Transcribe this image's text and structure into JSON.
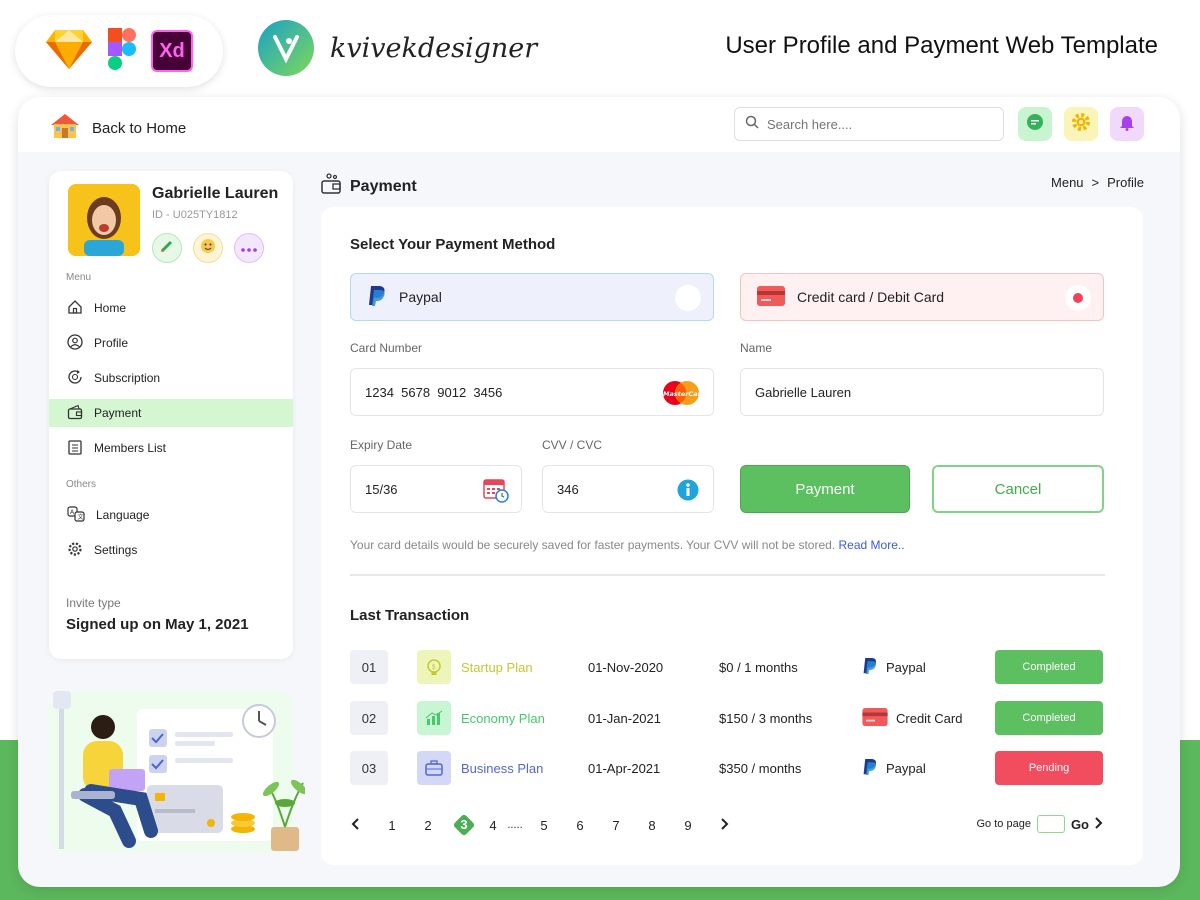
{
  "header": {
    "tools": [
      "sketch-icon",
      "figma-icon",
      "xd-icon"
    ],
    "xd_text": "Xd",
    "brand_name": "kvivekdesigner",
    "title": "User Profile and Payment Web Template"
  },
  "topbar": {
    "back_label": "Back to Home",
    "search_placeholder": "Search here....",
    "icons": [
      "chat-icon",
      "gear-icon",
      "notification-icon"
    ]
  },
  "profile": {
    "name": "Gabrielle Lauren",
    "id": "ID - U025TY1812"
  },
  "sidebar": {
    "menu_label": "Menu",
    "items": [
      {
        "label": "Home",
        "icon": "home-icon"
      },
      {
        "label": "Profile",
        "icon": "user-icon"
      },
      {
        "label": "Subscription",
        "icon": "subscription-icon"
      },
      {
        "label": "Payment",
        "icon": "wallet-icon"
      },
      {
        "label": "Members List",
        "icon": "list-icon"
      }
    ],
    "others_label": "Others",
    "others": [
      {
        "label": "Language",
        "icon": "language-icon"
      },
      {
        "label": "Settings",
        "icon": "settings-icon"
      }
    ],
    "invite_label": "Invite type",
    "invite_value": "Signed up on May 1, 2021"
  },
  "page": {
    "title": "Payment",
    "breadcrumb": [
      "Menu",
      "Profile"
    ],
    "breadcrumb_sep": ">"
  },
  "payment": {
    "section_title": "Select Your Payment Method",
    "methods": {
      "paypal": "Paypal",
      "card": "Credit card / Debit Card"
    },
    "card_number_label": "Card Number",
    "card_number_value": "1234  5678  9012  3456",
    "card_brand_text": "MasterCard",
    "name_label": "Name",
    "name_value": "Gabrielle Lauren",
    "expiry_label": "Expiry Date",
    "expiry_value": "15/36",
    "cvv_label": "CVV / CVC",
    "cvv_value": "346",
    "pay_button": "Payment",
    "cancel_button": "Cancel",
    "note": "Your card details would be securely saved for faster payments. Your CVV will not be stored.",
    "read_more": "Read More.."
  },
  "transactions": {
    "title": "Last Transaction",
    "rows": [
      {
        "no": "01",
        "plan": "Startup Plan",
        "date": "01-Nov-2020",
        "price": "$0 / 1 months",
        "method": "Paypal",
        "status": "Completed",
        "plan_color": "#c5c832",
        "plan_bg": "#eef5b8"
      },
      {
        "no": "02",
        "plan": "Economy Plan",
        "date": "01-Jan-2021",
        "price": "$150 / 3 months",
        "method": "Credit Card",
        "status": "Completed",
        "plan_color": "#45c96b",
        "plan_bg": "#c8f5d3"
      },
      {
        "no": "03",
        "plan": "Business Plan",
        "date": "01-Apr-2021",
        "price": "$350 /  months",
        "method": "Paypal",
        "status": "Pending",
        "plan_color": "#5566d8",
        "plan_bg": "#d3d8f7"
      }
    ]
  },
  "pagination": {
    "pages": [
      "1",
      "2",
      "3",
      "4",
      ".....",
      "5",
      "6",
      "7",
      "8",
      "9"
    ],
    "active": "3",
    "goto_label": "Go to page",
    "go_label": "Go"
  },
  "colors": {
    "accent": "#5cb85c",
    "pending": "#f24c5f",
    "sidebar_active": "#d4f7d1"
  }
}
